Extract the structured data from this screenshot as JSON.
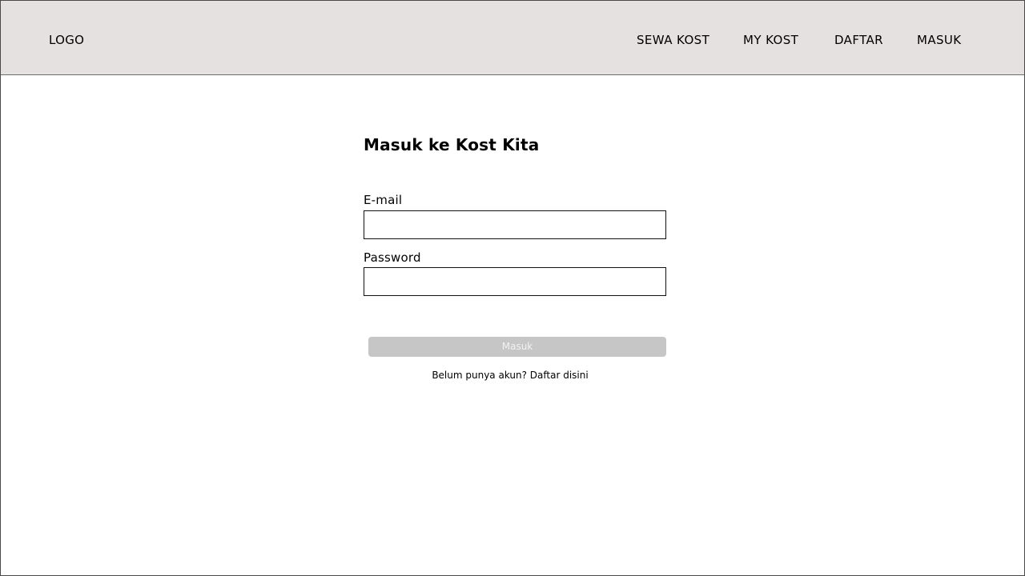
{
  "header": {
    "logo_text": "LOGO",
    "nav": {
      "sewa_kost": "SEWA KOST",
      "my_kost": "MY KOST",
      "daftar": "DAFTAR",
      "masuk": "MASUK"
    }
  },
  "login": {
    "title": "Masuk ke Kost Kita",
    "email_label": "E-mail",
    "email_value": "",
    "email_placeholder": "",
    "password_label": "Password",
    "password_value": "",
    "password_placeholder": "",
    "submit_label": "Masuk",
    "register_text": "Belum punya akun? Daftar disini"
  },
  "colors": {
    "header_background": "#e4e1e0",
    "button_background": "#c6c6c6",
    "button_text": "#f2f2f2",
    "text": "#000000"
  }
}
